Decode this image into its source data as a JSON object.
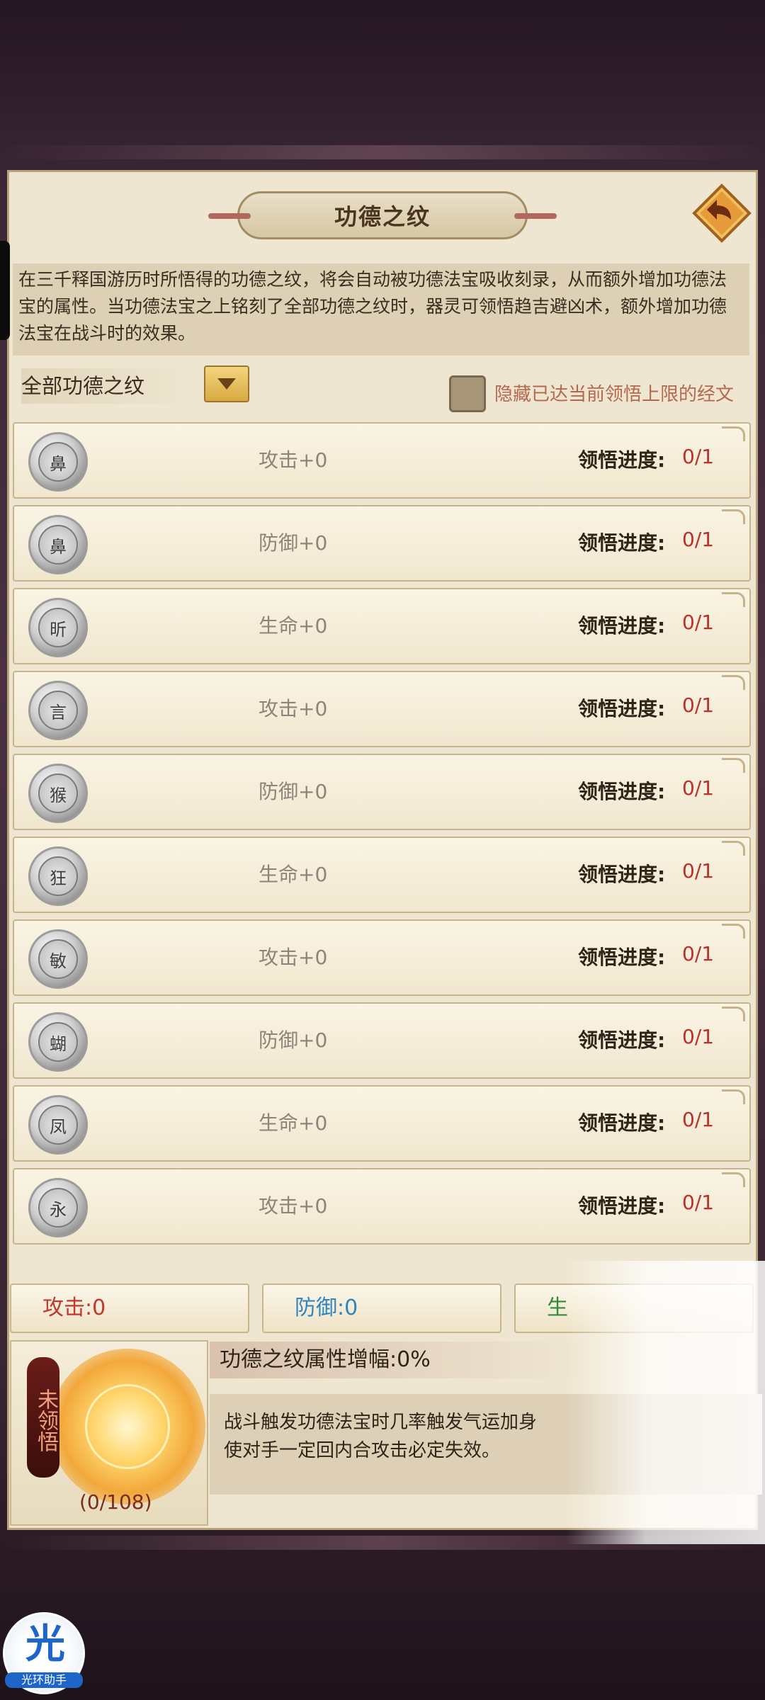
{
  "window": {
    "title": "功德之纹"
  },
  "description": "在三千释国游历时所悟得的功德之纹，将会自动被功德法宝吸收刻录，从而额外增加功德法宝的属性。当功德法宝之上铭刻了全部功德之纹时，器灵可领悟趋吉避凶术，额外增加功德法宝在战斗时的效果。",
  "filter": {
    "selected": "全部功德之纹",
    "dropdown_icon": "triangle-down"
  },
  "hide_option": {
    "label": "隐藏已达当前领悟上限的经文",
    "checked": false
  },
  "progress_label": "领悟进度:",
  "rows": [
    {
      "glyph": "鼻",
      "stat": "攻击+0",
      "progress": "0/1"
    },
    {
      "glyph": "鼻",
      "stat": "防御+0",
      "progress": "0/1"
    },
    {
      "glyph": "昕",
      "stat": "生命+0",
      "progress": "0/1"
    },
    {
      "glyph": "言",
      "stat": "攻击+0",
      "progress": "0/1"
    },
    {
      "glyph": "猴",
      "stat": "防御+0",
      "progress": "0/1"
    },
    {
      "glyph": "狂",
      "stat": "生命+0",
      "progress": "0/1"
    },
    {
      "glyph": "敏",
      "stat": "攻击+0",
      "progress": "0/1"
    },
    {
      "glyph": "蝴",
      "stat": "防御+0",
      "progress": "0/1"
    },
    {
      "glyph": "凤",
      "stat": "生命+0",
      "progress": "0/1"
    },
    {
      "glyph": "永",
      "stat": "攻击+0",
      "progress": "0/1"
    }
  ],
  "stats": {
    "attack": "攻击:0",
    "defense": "防御:0",
    "life_partial": "生"
  },
  "colors": {
    "attack": "#c0392b",
    "defense": "#2e86c1",
    "life": "#2e8b3a"
  },
  "bonus": {
    "status": "未领悟",
    "count": "(0/108)",
    "title": "功德之纹属性增幅:0%",
    "effect_line1": "战斗触发功德法宝时几率触发气运加身",
    "effect_line2": "使对手一定回内合攻击必定失效。"
  },
  "assistant": {
    "mark": "光",
    "name": "光环助手"
  }
}
